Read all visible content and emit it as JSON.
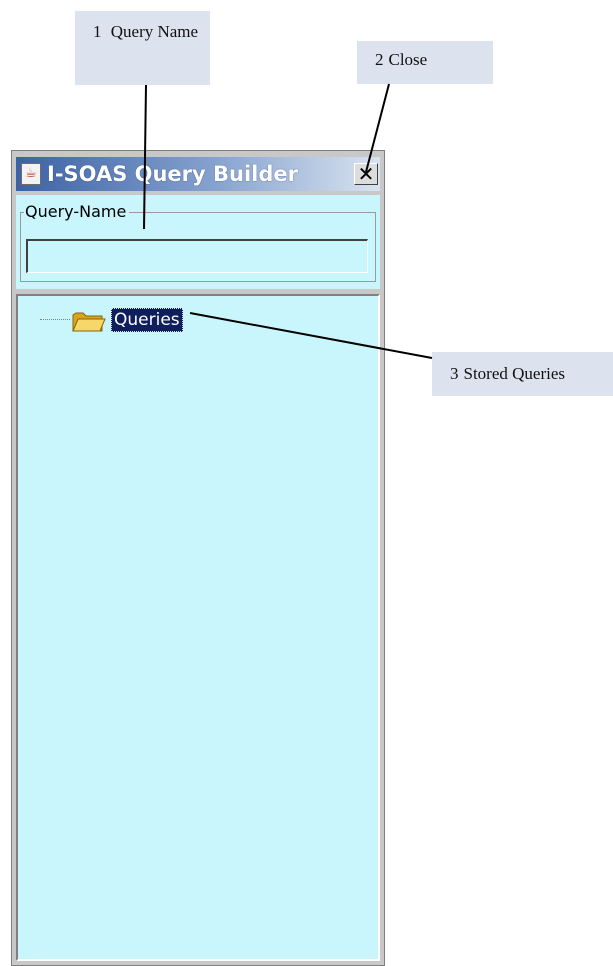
{
  "window": {
    "title": "I-SOAS Query Builder",
    "app_icon": "java-icon",
    "close_label": "✕"
  },
  "query_name": {
    "legend": "Query-Name",
    "value": "",
    "placeholder": ""
  },
  "tree": {
    "root": {
      "label": "Queries",
      "icon": "folder-icon",
      "selected": true
    }
  },
  "callouts": [
    {
      "number": "1",
      "text": "Query Name"
    },
    {
      "number": "2",
      "text": "Close"
    },
    {
      "number": "3",
      "text": "Stored Queries"
    }
  ],
  "colors": {
    "panel_background": "#c9f6fc",
    "titlebar_start": "#3c62a5",
    "callout_background": "#dce3ef",
    "selection": "#0f1e5c"
  }
}
